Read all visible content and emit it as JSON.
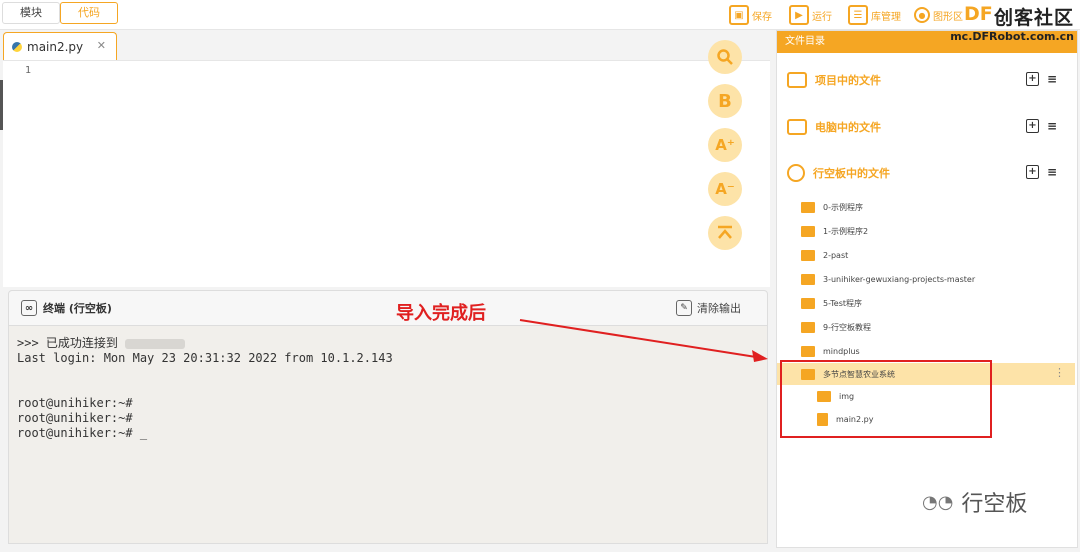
{
  "topbar": {
    "mode_blocks": "模块",
    "mode_code": "代码",
    "save": "保存",
    "run": "运行",
    "library": "库管理",
    "graphics": "图形区",
    "brand_df": "DF",
    "brand_name": "创客社区",
    "brand_url": "mc.DFRobot.com.cn"
  },
  "editor": {
    "file_tab": "main2.py",
    "close": "✕",
    "line1": "1",
    "fab_bold": "B",
    "fab_plus": "A⁺",
    "fab_minus": "A⁻"
  },
  "terminal": {
    "title": "终端 (行空板)",
    "clear": "清除输出",
    "line1": ">>> 已成功连接到",
    "line2": "Last login: Mon May 23 20:31:32 2022 from 10.1.2.143",
    "line3": "root@unihiker:~#",
    "line4": "root@unihiker:~#",
    "line5": "root@unihiker:~# _"
  },
  "annotation": "导入完成后",
  "files": {
    "header": "文件目录",
    "project": "项目中的文件",
    "computer": "电脑中的文件",
    "board": "行空板中的文件",
    "items": [
      "0-示例程序",
      "1-示例程序2",
      "2-past",
      "3-unihiker-gewuxiang-projects-master",
      "5-Test程序",
      "9-行空板教程",
      "mindplus",
      "多节点智慧农业系统",
      "img",
      "main2.py"
    ]
  },
  "watermark": "行空板"
}
